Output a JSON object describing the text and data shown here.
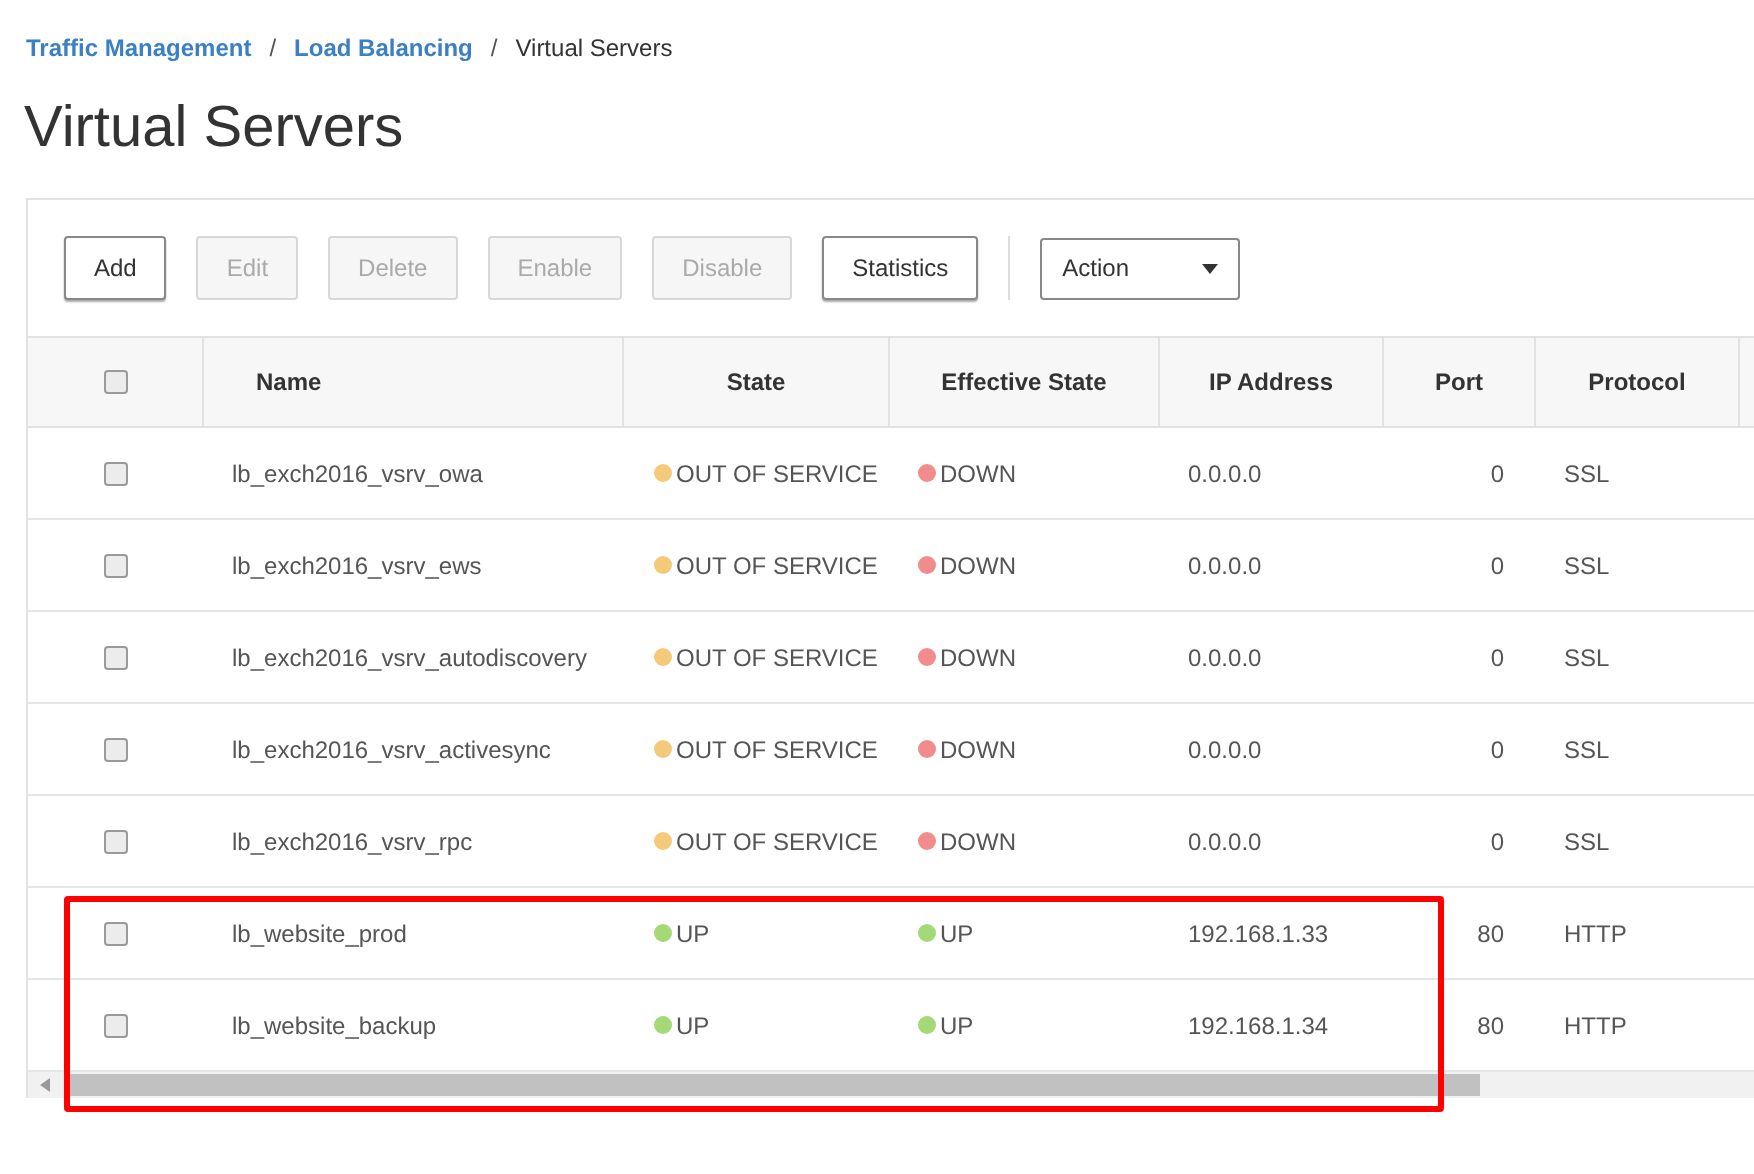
{
  "breadcrumbs": [
    {
      "label": "Traffic Management",
      "link": true
    },
    {
      "label": "Load Balancing",
      "link": true
    },
    {
      "label": "Virtual Servers",
      "link": false
    }
  ],
  "breadcrumb_separators": [
    "/",
    "/"
  ],
  "title": "Virtual Servers",
  "toolbar": {
    "buttons": [
      {
        "label": "Add",
        "disabled": false
      },
      {
        "label": "Edit",
        "disabled": true
      },
      {
        "label": "Delete",
        "disabled": true
      },
      {
        "label": "Enable",
        "disabled": true
      },
      {
        "label": "Disable",
        "disabled": true
      },
      {
        "label": "Statistics",
        "disabled": false
      }
    ],
    "action": {
      "label": "Action"
    }
  },
  "table": {
    "columns": [
      "Name",
      "State",
      "Effective State",
      "IP Address",
      "Port",
      "Protocol"
    ],
    "select_all_checked": false,
    "rows": [
      {
        "checked": false,
        "name": "lb_exch2016_vsrv_owa",
        "state": {
          "label": "OUT OF SERVICE",
          "color": "#f5c97a"
        },
        "effective_state": {
          "label": "DOWN",
          "color": "#f08c8c"
        },
        "ip": "0.0.0.0",
        "port": "0",
        "protocol": "SSL"
      },
      {
        "checked": false,
        "name": "lb_exch2016_vsrv_ews",
        "state": {
          "label": "OUT OF SERVICE",
          "color": "#f5c97a"
        },
        "effective_state": {
          "label": "DOWN",
          "color": "#f08c8c"
        },
        "ip": "0.0.0.0",
        "port": "0",
        "protocol": "SSL"
      },
      {
        "checked": false,
        "name": "lb_exch2016_vsrv_autodiscovery",
        "state": {
          "label": "OUT OF SERVICE",
          "color": "#f5c97a"
        },
        "effective_state": {
          "label": "DOWN",
          "color": "#f08c8c"
        },
        "ip": "0.0.0.0",
        "port": "0",
        "protocol": "SSL"
      },
      {
        "checked": false,
        "name": "lb_exch2016_vsrv_activesync",
        "state": {
          "label": "OUT OF SERVICE",
          "color": "#f5c97a"
        },
        "effective_state": {
          "label": "DOWN",
          "color": "#f08c8c"
        },
        "ip": "0.0.0.0",
        "port": "0",
        "protocol": "SSL"
      },
      {
        "checked": false,
        "name": "lb_exch2016_vsrv_rpc",
        "state": {
          "label": "OUT OF SERVICE",
          "color": "#f5c97a"
        },
        "effective_state": {
          "label": "DOWN",
          "color": "#f08c8c"
        },
        "ip": "0.0.0.0",
        "port": "0",
        "protocol": "SSL"
      },
      {
        "checked": false,
        "name": "lb_website_prod",
        "state": {
          "label": "UP",
          "color": "#a3d977"
        },
        "effective_state": {
          "label": "UP",
          "color": "#a3d977"
        },
        "ip": "192.168.1.33",
        "port": "80",
        "protocol": "HTTP"
      },
      {
        "checked": false,
        "name": "lb_website_backup",
        "state": {
          "label": "UP",
          "color": "#a3d977"
        },
        "effective_state": {
          "label": "UP",
          "color": "#a3d977"
        },
        "ip": "192.168.1.34",
        "port": "80",
        "protocol": "HTTP"
      }
    ]
  }
}
